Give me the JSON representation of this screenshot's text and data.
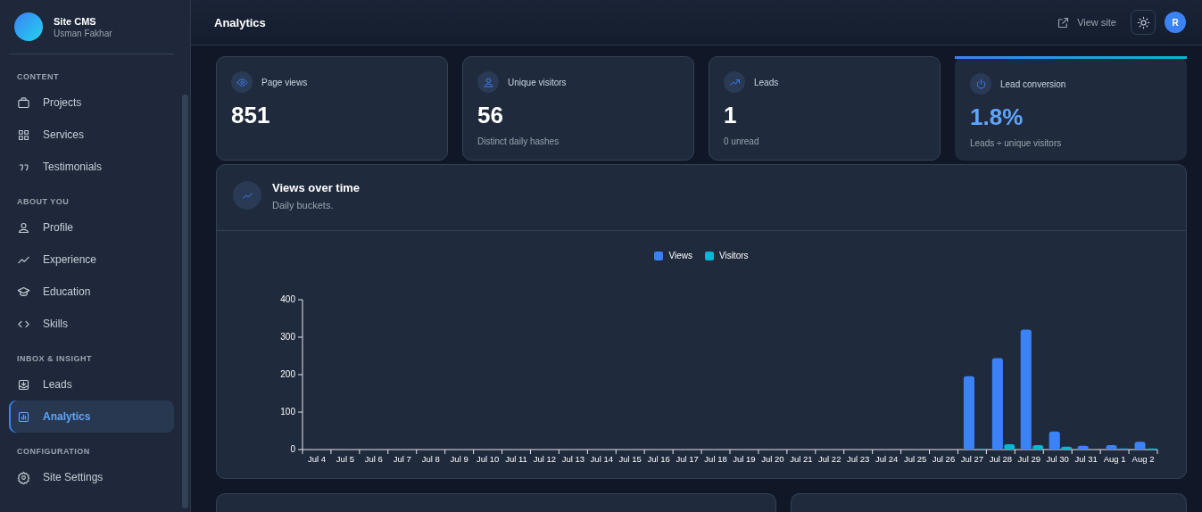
{
  "brand": {
    "title": "Site CMS",
    "subtitle": "Usman Fakhar"
  },
  "sidebar": {
    "sections": [
      {
        "heading": "CONTENT",
        "items": [
          {
            "label": "Projects",
            "selected": false
          },
          {
            "label": "Services",
            "selected": false
          },
          {
            "label": "Testimonials",
            "selected": false
          }
        ]
      },
      {
        "heading": "ABOUT YOU",
        "items": [
          {
            "label": "Profile",
            "selected": false
          },
          {
            "label": "Experience",
            "selected": false
          },
          {
            "label": "Education",
            "selected": false
          },
          {
            "label": "Skills",
            "selected": false
          }
        ]
      },
      {
        "heading": "INBOX & INSIGHT",
        "items": [
          {
            "label": "Leads",
            "selected": false
          },
          {
            "label": "Analytics",
            "selected": true
          }
        ]
      },
      {
        "heading": "CONFIGURATION",
        "items": [
          {
            "label": "Site Settings",
            "selected": false
          }
        ]
      }
    ]
  },
  "header": {
    "title": "Analytics",
    "view_site": "View site",
    "avatar": "R"
  },
  "stats": [
    {
      "label": "Page views",
      "value": "851",
      "highlight": false
    },
    {
      "label": "Unique visitors",
      "value": "56",
      "note": "Distinct daily hashes",
      "highlight": false
    },
    {
      "label": "Leads",
      "value": "1",
      "note": "0 unread",
      "highlight": false
    },
    {
      "label": "Lead conversion",
      "value": "1.8%",
      "note": "Leads ÷ unique visitors",
      "highlight": true
    }
  ],
  "views_panel": {
    "title": "Views over time",
    "subtitle": "Daily buckets.",
    "chart_data": {
      "type": "bar",
      "categories": [
        "Jul 4",
        "Jul 5",
        "Jul 6",
        "Jul 7",
        "Jul 8",
        "Jul 9",
        "Jul 10",
        "Jul 11",
        "Jul 12",
        "Jul 13",
        "Jul 14",
        "Jul 15",
        "Jul 16",
        "Jul 17",
        "Jul 18",
        "Jul 19",
        "Jul 20",
        "Jul 21",
        "Jul 22",
        "Jul 23",
        "Jul 24",
        "Jul 25",
        "Jul 26",
        "Jul 27",
        "Jul 28",
        "Jul 29",
        "Jul 30",
        "Jul 31",
        "Aug 1",
        "Aug 2"
      ],
      "series": [
        {
          "name": "Views",
          "color": "#3b82f6",
          "values": [
            0,
            0,
            0,
            0,
            0,
            0,
            0,
            0,
            0,
            0,
            0,
            0,
            0,
            0,
            0,
            0,
            0,
            0,
            0,
            0,
            0,
            0,
            0,
            196,
            244,
            320,
            48,
            10,
            12,
            21
          ]
        },
        {
          "name": "Visitors",
          "color": "#06b6d4",
          "values": [
            0,
            0,
            0,
            0,
            0,
            0,
            0,
            0,
            0,
            0,
            0,
            0,
            0,
            0,
            0,
            0,
            0,
            0,
            0,
            0,
            0,
            0,
            0,
            2,
            14,
            12,
            8,
            null,
            3,
            3
          ]
        }
      ],
      "ylim": [
        0,
        400
      ],
      "yticks": [
        0,
        100,
        200,
        300,
        400
      ]
    }
  }
}
